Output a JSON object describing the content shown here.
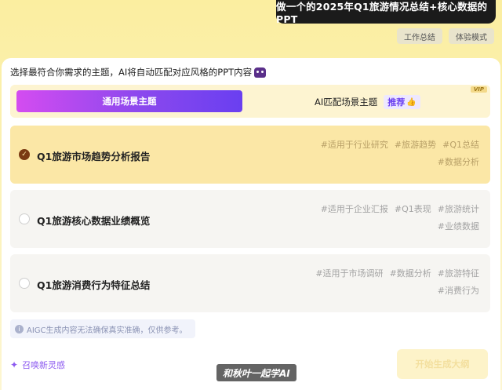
{
  "prompt": "做一个的2025年Q1旅游情况总结+核心数据的PPT",
  "chips": [
    "工作总结",
    "体验模式"
  ],
  "intro": "选择最符合你需求的主题，AI将自动匹配对应风格的PPT内容",
  "tabs": {
    "active": "通用场景主题",
    "other": "AI匹配场景主题",
    "recommend": "推荐",
    "vip": "VIP"
  },
  "cards": [
    {
      "title": "Q1旅游市场趋势分析报告",
      "selected": true,
      "tags": [
        "#适用于行业研究",
        "#旅游趋势",
        "#Q1总结",
        "#数据分析"
      ]
    },
    {
      "title": "Q1旅游核心数据业绩概览",
      "selected": false,
      "tags": [
        "#适用于企业汇报",
        "#Q1表现",
        "#旅游统计",
        "#业绩数据"
      ]
    },
    {
      "title": "Q1旅游消费行为特征总结",
      "selected": false,
      "tags": [
        "#适用于市场调研",
        "#数据分析",
        "#旅游特征",
        "#消费行为"
      ]
    }
  ],
  "disclaimer": "AIGC生成内容无法确保真实准确，仅供参考。",
  "summon": "召唤新灵感",
  "watermark": "和秋叶一起学AI",
  "generate_button": "开始生成大纲",
  "colors": {
    "accent_start": "#d44cf0",
    "accent_end": "#6a3ff0",
    "selected_bg": "#fbe7a6"
  }
}
